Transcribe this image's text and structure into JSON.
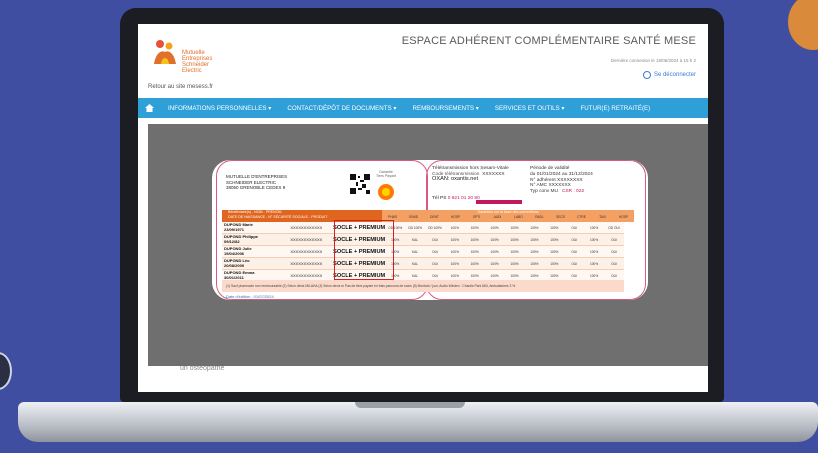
{
  "site": {
    "logo_lines": [
      "Mutuelle",
      "Entreprises",
      "Schneider",
      "Electric"
    ],
    "back_link": "Retour au site mesess.fr",
    "title": "ESPACE ADHÉRENT COMPLÉMENTAIRE SANTÉ MESE",
    "user_info": "Dernière connexion le 18/06/2024 à 15 h 2",
    "logout": "Se déconnecter"
  },
  "nav": {
    "items": [
      "INFORMATIONS PERSONNELLES ▾",
      "CONTACT/DÉPÔT DE DOCUMENTS ▾",
      "REMBOURSEMENTS ▾",
      "SERVICES ET OUTILS ▾",
      "FUTUR(E) RETRAITÉ(E)"
    ]
  },
  "below_text": "un ostéopathe",
  "card": {
    "address": [
      "MUTUELLE D'ENTREPRISES",
      "SCHNEIDER ELECTRIC",
      "38050 GRENOBLE CEDEX 9"
    ],
    "small_label": [
      "Garantie",
      "Tiers Payant"
    ],
    "tp": {
      "line1": "Télétransmission hors Sesam-Vitale",
      "line2_label": "Code télétransmission",
      "line2_value": "XXXXXXX",
      "oxan": "OXAN: oxantis.net"
    },
    "tiers": {
      "label": "Tél PS",
      "number": "0 821 01 20 80"
    },
    "validity": {
      "title": "Période de validité",
      "from_label": "du",
      "from": "01/01/2024",
      "to_label": "au",
      "to": "31/12/2024",
      "adherent_label": "N° adhérent",
      "adherent": "XXXXXXXX",
      "amc_label": "N° AMC",
      "amc": "XXXXXXX",
      "type_label": "Typ conv",
      "type": "MU",
      "csr_label": "CSR :",
      "csr": "022"
    },
    "benef_head": [
      "Bénéficiaire(s) - NOM - PRÉNOM",
      "DATE DE NAISSANCE - N° SÉCURITÉ SOCIALE - PRODUIT"
    ],
    "garanties_head": "Garanties sur la base des conventions",
    "columns": [
      "PHAR",
      "SVMD",
      "DENT",
      "HOSP",
      "OPTI",
      "AUDI",
      "LABO",
      "RADL",
      "SECS",
      "CTRE",
      "TAXI",
      "HOSP",
      "EXOS",
      "CENT",
      "DIVE"
    ],
    "rows": [
      {
        "name": "DUPOND Marie",
        "birth": "23/09/1971",
        "id": "XXXXXXXXXXXX",
        "product": "SOCLE + PREMIUM",
        "vals": [
          "OD 100%",
          "OD 100%",
          "OD 100%",
          "100%",
          "100%",
          "100%",
          "100%",
          "100%",
          "100%",
          "OUI",
          "100%",
          "OD OUI"
        ]
      },
      {
        "name": "DUPOND Philippe",
        "birth": "09/12/82",
        "id": "XXXXXXXXXXXX",
        "product": "SOCLE + PREMIUM",
        "vals": [
          "100%",
          "KAL",
          "OUI",
          "100%",
          "100%",
          "100%",
          "100%",
          "100%",
          "100%",
          "OUI",
          "100%",
          "OUI"
        ]
      },
      {
        "name": "DUPOND Julie",
        "birth": "15/04/2006",
        "id": "XXXXXXXXXXXX",
        "product": "SOCLE + PREMIUM",
        "vals": [
          "100%",
          "KAL",
          "OUI",
          "100%",
          "100%",
          "100%",
          "100%",
          "100%",
          "100%",
          "OUI",
          "100%",
          "OUI"
        ]
      },
      {
        "name": "DUPOND Léo",
        "birth": "20/08/2009",
        "id": "XXXXXXXXXXXX",
        "product": "SOCLE + PREMIUM",
        "vals": [
          "100%",
          "KAL",
          "OUI",
          "100%",
          "100%",
          "100%",
          "100%",
          "100%",
          "100%",
          "OUI",
          "100%",
          "OUI"
        ]
      },
      {
        "name": "DUPOND Emma",
        "birth": "30/01/2011",
        "id": "XXXXXXXXXXXX",
        "product": "SOCLE + PREMIUM",
        "vals": [
          "100%",
          "KAL",
          "OUI",
          "100%",
          "100%",
          "100%",
          "100%",
          "100%",
          "100%",
          "OUI",
          "100%",
          "OUI"
        ]
      }
    ],
    "notes": "(1) Sauf pharmacie non remboursable  (2) Selon devis MILAHA  (3) Selon devis m  Pas de tiers payant en frais parcours de soins  (5) Montant / jour, Audio Windex : Chantis Park 684, Ambulatoires 3 %",
    "edit_date": "Date d'édition : 01/07/2024"
  }
}
